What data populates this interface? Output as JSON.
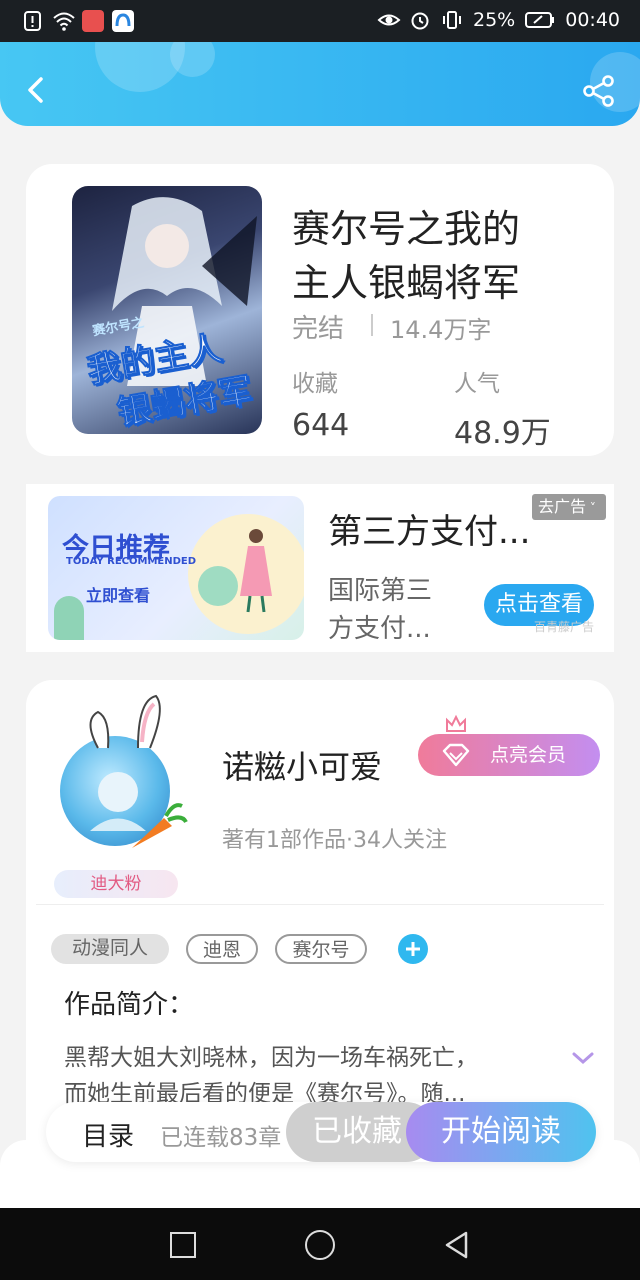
{
  "status_bar": {
    "battery": "25%",
    "time": "00:40"
  },
  "book": {
    "title_line1": "赛尔号之我的",
    "title_line2": "主人银蝎将军",
    "status": "完结",
    "word_count": "14.4万字",
    "favorites_label": "收藏",
    "favorites_value": "644",
    "popularity_label": "人气",
    "popularity_value": "48.9万",
    "cover_text_line1": "我的主人",
    "cover_text_line2": "银蝎将军",
    "cover_small_text": "赛尔号之"
  },
  "ad": {
    "banner_title": "今日推荐",
    "banner_subtitle": "TODAY RECOMMENDED",
    "banner_button": "立即查看",
    "title": "第三方支付...",
    "desc_line1": "国际第三",
    "desc_line2": "方支付...",
    "remove_label": "去广告",
    "cta": "点击查看",
    "source": "百青藤广告"
  },
  "author": {
    "name": "诺糍小可爱",
    "vip_label": "点亮会员",
    "stats": "著有1部作品·34人关注",
    "fan_badge": "迪大粉"
  },
  "tags": [
    "动漫同人",
    "迪恩",
    "赛尔号"
  ],
  "intro": {
    "heading": "作品简介：",
    "line1": "黑帮大姐大刘晓林，因为一场车祸死亡，",
    "line2": "而她生前最后看的便是《赛尔号》。随..."
  },
  "bottom": {
    "toc": "目录",
    "serial": "已连载83章",
    "collected": "已收藏",
    "start": "开始阅读"
  },
  "colors": {
    "accent": "#2aa8f0",
    "vip": "#f07b9a",
    "read": "#9b7df0"
  }
}
